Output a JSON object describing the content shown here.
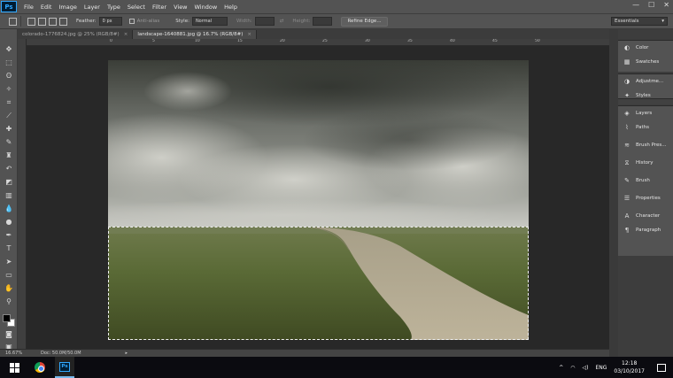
{
  "app": {
    "logo": "Ps"
  },
  "menu": [
    "File",
    "Edit",
    "Image",
    "Layer",
    "Type",
    "Select",
    "Filter",
    "View",
    "Window",
    "Help"
  ],
  "window_controls": {
    "minimize": "—",
    "maximize": "☐",
    "close": "✕"
  },
  "options_bar": {
    "feather_label": "Feather:",
    "feather_value": "0 px",
    "antialias_label": "Anti-alias",
    "style_label": "Style:",
    "style_value": "Normal",
    "width_label": "Width:",
    "height_label": "Height:",
    "refine_edge": "Refine Edge...",
    "workspace": "Essentials"
  },
  "tabs": [
    {
      "label": "colorado-1776824.jpg @ 25% (RGB/8#)",
      "close": "×",
      "active": false
    },
    {
      "label": "landscape-1640881.jpg @ 16.7% (RGB/8#)",
      "close": "×",
      "active": true
    }
  ],
  "ruler": {
    "labels": [
      "0",
      "5",
      "10",
      "15",
      "20",
      "25",
      "30",
      "35",
      "40",
      "45",
      "50"
    ]
  },
  "status": {
    "zoom": "16.67%",
    "doc": "Doc: 50.0M/50.0M"
  },
  "panels": {
    "group1": [
      {
        "icon": "color-wheel-icon",
        "glyph": "◐",
        "label": "Color"
      },
      {
        "icon": "swatches-icon",
        "glyph": "▦",
        "label": "Swatches"
      }
    ],
    "group2": [
      {
        "icon": "adjustments-icon",
        "glyph": "◑",
        "label": "Adjustme..."
      },
      {
        "icon": "styles-icon",
        "glyph": "✦",
        "label": "Styles"
      }
    ],
    "group3": [
      {
        "icon": "layers-icon",
        "glyph": "◈",
        "label": "Layers"
      },
      {
        "icon": "paths-icon",
        "glyph": "⌇",
        "label": "Paths"
      },
      {
        "icon": "brush-presets-icon",
        "glyph": "≋",
        "label": "Brush Pres..."
      },
      {
        "icon": "history-icon",
        "glyph": "⧖",
        "label": "History"
      },
      {
        "icon": "brush-icon",
        "glyph": "✎",
        "label": "Brush"
      },
      {
        "icon": "properties-icon",
        "glyph": "☰",
        "label": "Properties"
      },
      {
        "icon": "character-icon",
        "glyph": "A",
        "label": "Character"
      },
      {
        "icon": "paragraph-icon",
        "glyph": "¶",
        "label": "Paragraph"
      }
    ]
  },
  "taskbar": {
    "lang": "ENG",
    "time": "12:18",
    "date": "03/10/2017",
    "tray_glyphs": {
      "chevron": "^",
      "network": "◠",
      "volume": "◁)"
    }
  },
  "colors": {
    "chrome": "#535353",
    "workspace": "#282828",
    "taskbar": "#0b0b10",
    "accent": "#31a8ff"
  }
}
